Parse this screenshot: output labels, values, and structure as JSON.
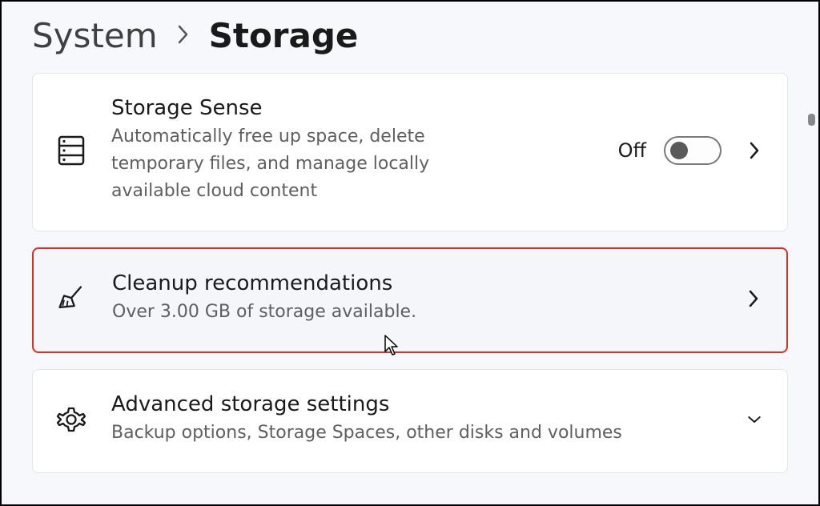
{
  "breadcrumb": {
    "parent": "System",
    "current": "Storage"
  },
  "cards": {
    "storage_sense": {
      "title": "Storage Sense",
      "desc": "Automatically free up space, delete temporary files, and manage locally available cloud content",
      "toggle_state_label": "Off",
      "toggle_on": false
    },
    "cleanup": {
      "title": "Cleanup recommendations",
      "desc": "Over 3.00 GB of storage available."
    },
    "advanced": {
      "title": "Advanced storage settings",
      "desc": "Backup options, Storage Spaces, other disks and volumes"
    }
  }
}
